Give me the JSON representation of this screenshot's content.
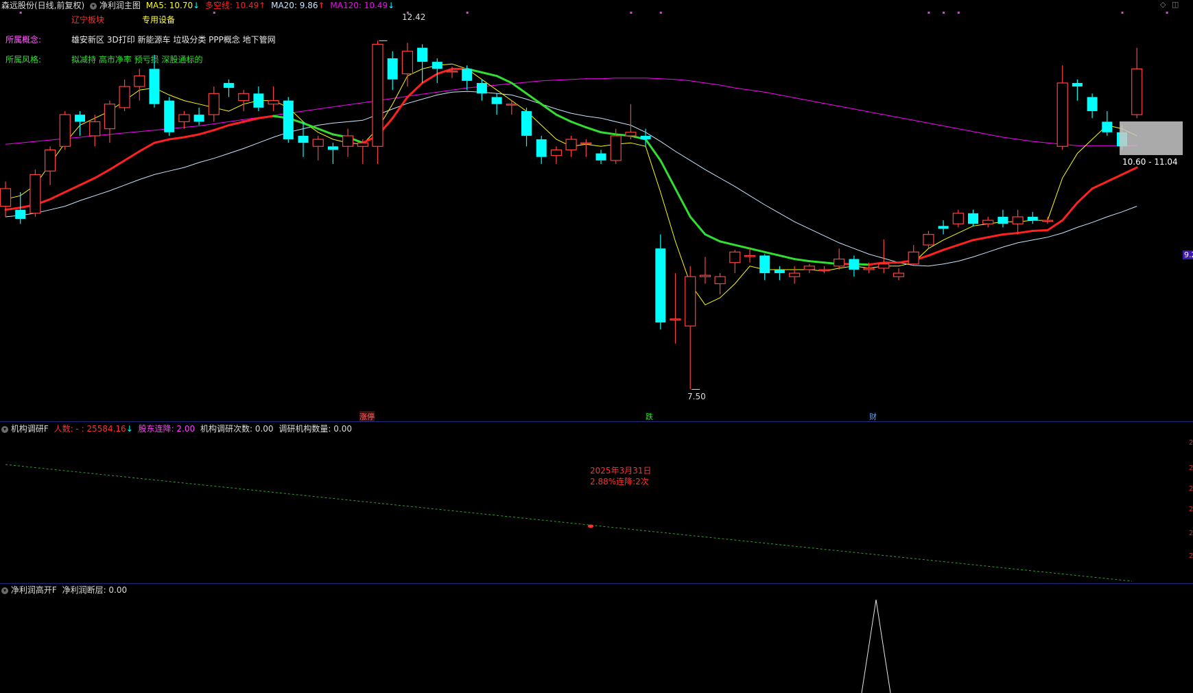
{
  "header": {
    "stock": "森远股份(日线,前复权)",
    "indicator": "净利润主图",
    "ma5_label": "MA5: 10.70",
    "ma5_arrow": "↓",
    "duokong_label": "多空线: 10.49",
    "duokong_arrow": "↑",
    "ma20_label": "MA20: 9.86",
    "ma20_arrow": "↑",
    "ma120_label": "MA120: 10.49",
    "ma120_arrow": "↓"
  },
  "info": {
    "sector": "辽宁板块",
    "equipment": "专用设备",
    "concept_label": "所属概念:",
    "concept_value": "雄安新区 3D打印 新能源车 垃圾分类 PPP概念 地下管网",
    "style_label": "所属风格:",
    "style_value": "拟减持 高市净率 预亏损 深股通标的"
  },
  "annotations": {
    "high": "12.42",
    "low": "7.50",
    "range_box": "10.60 - 11.04",
    "price_tag": "9.2",
    "event1": "涨停",
    "event2": "跌",
    "event3": "财"
  },
  "panel2": {
    "title": "机构调研F",
    "people_label": "人数: - : 25584.16",
    "people_arrow": "↓",
    "holder_label": "股东连降: 2.00",
    "visits_label": "机构调研次数: 0.00",
    "orgs_label": "调研机构数量: 0.00",
    "note_date": "2025年3月31日",
    "note_text": "2.88%连降:2次"
  },
  "panel3": {
    "title": "净利润高开F",
    "label": "净利润断层: 0.00"
  },
  "colors": {
    "up": "#ff4040",
    "down": "#00ffff",
    "ma5": "#ffff00",
    "ma120": "#ff00ff",
    "ma20": "#c8e6ff",
    "duokong_up": "#ff2020",
    "duokong_down": "#30e030",
    "panel_border": "#1e2a80"
  },
  "chart_data": {
    "type": "candlestick",
    "candles": [
      {
        "o": 10.1,
        "h": 10.45,
        "l": 9.95,
        "c": 10.35
      },
      {
        "o": 10.05,
        "h": 10.3,
        "l": 9.85,
        "c": 9.92
      },
      {
        "o": 10.0,
        "h": 10.62,
        "l": 9.95,
        "c": 10.55
      },
      {
        "o": 10.6,
        "h": 10.95,
        "l": 10.4,
        "c": 10.9
      },
      {
        "o": 10.95,
        "h": 11.45,
        "l": 10.9,
        "c": 11.4
      },
      {
        "o": 11.4,
        "h": 11.45,
        "l": 11.1,
        "c": 11.3
      },
      {
        "o": 11.1,
        "h": 11.4,
        "l": 10.95,
        "c": 11.3
      },
      {
        "o": 11.2,
        "h": 11.6,
        "l": 11.0,
        "c": 11.55
      },
      {
        "o": 11.5,
        "h": 11.9,
        "l": 11.45,
        "c": 11.8
      },
      {
        "o": 11.8,
        "h": 12.05,
        "l": 11.6,
        "c": 11.95
      },
      {
        "o": 12.05,
        "h": 12.25,
        "l": 11.5,
        "c": 11.55
      },
      {
        "o": 11.6,
        "h": 11.65,
        "l": 11.1,
        "c": 11.15
      },
      {
        "o": 11.3,
        "h": 11.45,
        "l": 11.2,
        "c": 11.4
      },
      {
        "o": 11.4,
        "h": 11.5,
        "l": 11.25,
        "c": 11.3
      },
      {
        "o": 11.4,
        "h": 11.8,
        "l": 11.3,
        "c": 11.7
      },
      {
        "o": 11.85,
        "h": 11.9,
        "l": 11.65,
        "c": 11.78
      },
      {
        "o": 11.6,
        "h": 11.75,
        "l": 11.45,
        "c": 11.7
      },
      {
        "o": 11.7,
        "h": 11.8,
        "l": 11.45,
        "c": 11.5
      },
      {
        "o": 11.55,
        "h": 11.8,
        "l": 11.45,
        "c": 11.6
      },
      {
        "o": 11.6,
        "h": 11.65,
        "l": 11.0,
        "c": 11.05
      },
      {
        "o": 11.1,
        "h": 11.3,
        "l": 10.8,
        "c": 11.0
      },
      {
        "o": 10.95,
        "h": 11.1,
        "l": 10.75,
        "c": 11.05
      },
      {
        "o": 10.95,
        "h": 11.0,
        "l": 10.7,
        "c": 10.9
      },
      {
        "o": 10.95,
        "h": 11.2,
        "l": 10.8,
        "c": 11.1
      },
      {
        "o": 10.95,
        "h": 11.05,
        "l": 10.7,
        "c": 11.0
      },
      {
        "o": 10.95,
        "h": 12.45,
        "l": 10.7,
        "c": 12.4
      },
      {
        "o": 12.2,
        "h": 12.3,
        "l": 11.75,
        "c": 11.9
      },
      {
        "o": 11.98,
        "h": 12.42,
        "l": 11.8,
        "c": 12.3
      },
      {
        "o": 12.35,
        "h": 12.4,
        "l": 11.85,
        "c": 12.15
      },
      {
        "o": 12.15,
        "h": 12.2,
        "l": 11.85,
        "c": 12.05
      },
      {
        "o": 12.02,
        "h": 12.08,
        "l": 11.92,
        "c": 12.02
      },
      {
        "o": 12.05,
        "h": 12.1,
        "l": 11.75,
        "c": 11.88
      },
      {
        "o": 11.85,
        "h": 11.9,
        "l": 11.6,
        "c": 11.7
      },
      {
        "o": 11.65,
        "h": 11.7,
        "l": 11.4,
        "c": 11.55
      },
      {
        "o": 11.55,
        "h": 11.6,
        "l": 11.4,
        "c": 11.55
      },
      {
        "o": 11.45,
        "h": 11.5,
        "l": 10.95,
        "c": 11.1
      },
      {
        "o": 11.05,
        "h": 11.1,
        "l": 10.7,
        "c": 10.8
      },
      {
        "o": 10.82,
        "h": 10.95,
        "l": 10.7,
        "c": 10.9
      },
      {
        "o": 10.9,
        "h": 11.1,
        "l": 10.8,
        "c": 11.05
      },
      {
        "o": 11.0,
        "h": 11.05,
        "l": 10.8,
        "c": 11.0
      },
      {
        "o": 10.85,
        "h": 10.9,
        "l": 10.7,
        "c": 10.75
      },
      {
        "o": 10.75,
        "h": 11.2,
        "l": 10.7,
        "c": 11.1
      },
      {
        "o": 11.1,
        "h": 11.55,
        "l": 11.05,
        "c": 11.15
      },
      {
        "o": 11.1,
        "h": 11.2,
        "l": 10.95,
        "c": 11.05
      },
      {
        "o": 9.5,
        "h": 9.7,
        "l": 8.35,
        "c": 8.45
      },
      {
        "o": 8.5,
        "h": 9.15,
        "l": 8.15,
        "c": 8.5
      },
      {
        "o": 8.4,
        "h": 9.25,
        "l": 7.5,
        "c": 9.1
      },
      {
        "o": 9.1,
        "h": 9.38,
        "l": 9.0,
        "c": 9.12
      },
      {
        "o": 9.0,
        "h": 9.15,
        "l": 8.85,
        "c": 9.1
      },
      {
        "o": 9.3,
        "h": 9.48,
        "l": 9.15,
        "c": 9.45
      },
      {
        "o": 9.4,
        "h": 9.5,
        "l": 9.3,
        "c": 9.4
      },
      {
        "o": 9.4,
        "h": 9.42,
        "l": 9.05,
        "c": 9.15
      },
      {
        "o": 9.2,
        "h": 9.25,
        "l": 9.05,
        "c": 9.15
      },
      {
        "o": 9.1,
        "h": 9.25,
        "l": 9.0,
        "c": 9.15
      },
      {
        "o": 9.2,
        "h": 9.28,
        "l": 9.15,
        "c": 9.25
      },
      {
        "o": 9.2,
        "h": 9.25,
        "l": 9.15,
        "c": 9.2
      },
      {
        "o": 9.25,
        "h": 9.5,
        "l": 9.2,
        "c": 9.35
      },
      {
        "o": 9.35,
        "h": 9.4,
        "l": 9.1,
        "c": 9.2
      },
      {
        "o": 9.2,
        "h": 9.3,
        "l": 9.15,
        "c": 9.22
      },
      {
        "o": 9.22,
        "h": 9.63,
        "l": 9.15,
        "c": 9.28
      },
      {
        "o": 9.1,
        "h": 9.22,
        "l": 9.05,
        "c": 9.15
      },
      {
        "o": 9.28,
        "h": 9.55,
        "l": 9.25,
        "c": 9.45
      },
      {
        "o": 9.55,
        "h": 9.75,
        "l": 9.5,
        "c": 9.7
      },
      {
        "o": 9.82,
        "h": 9.9,
        "l": 9.7,
        "c": 9.78
      },
      {
        "o": 9.85,
        "h": 10.05,
        "l": 9.8,
        "c": 10.0
      },
      {
        "o": 10.0,
        "h": 10.05,
        "l": 9.82,
        "c": 9.85
      },
      {
        "o": 9.85,
        "h": 9.95,
        "l": 9.8,
        "c": 9.9
      },
      {
        "o": 9.95,
        "h": 10.05,
        "l": 9.8,
        "c": 9.85
      },
      {
        "o": 9.85,
        "h": 10.05,
        "l": 9.7,
        "c": 9.95
      },
      {
        "o": 9.95,
        "h": 10.02,
        "l": 9.85,
        "c": 9.9
      },
      {
        "o": 9.9,
        "h": 9.95,
        "l": 9.85,
        "c": 9.9
      },
      {
        "o": 10.95,
        "h": 12.1,
        "l": 10.9,
        "c": 11.85
      },
      {
        "o": 11.85,
        "h": 11.9,
        "l": 11.6,
        "c": 11.8
      },
      {
        "o": 11.65,
        "h": 11.7,
        "l": 11.35,
        "c": 11.45
      },
      {
        "o": 11.3,
        "h": 11.45,
        "l": 11.1,
        "c": 11.15
      },
      {
        "o": 11.15,
        "h": 11.25,
        "l": 10.9,
        "c": 10.95
      },
      {
        "o": 11.4,
        "h": 12.35,
        "l": 11.35,
        "c": 12.05
      }
    ],
    "ma5": [
      10.2,
      10.25,
      10.4,
      10.7,
      11.0,
      11.25,
      11.35,
      11.45,
      11.6,
      11.75,
      11.78,
      11.68,
      11.6,
      11.55,
      11.5,
      11.45,
      11.55,
      11.6,
      11.6,
      11.5,
      11.3,
      11.15,
      11.05,
      11.0,
      10.98,
      11.2,
      11.55,
      11.95,
      12.05,
      12.1,
      12.12,
      12.05,
      11.9,
      11.75,
      11.6,
      11.45,
      11.25,
      11.05,
      10.95,
      10.98,
      10.95,
      10.98,
      11.0,
      10.95,
      10.3,
      9.6,
      9.0,
      8.7,
      8.8,
      9.0,
      9.25,
      9.2,
      9.2,
      9.2,
      9.2,
      9.18,
      9.22,
      9.25,
      9.22,
      9.25,
      9.25,
      9.3,
      9.5,
      9.62,
      9.72,
      9.82,
      9.85,
      9.88,
      9.88,
      9.9,
      9.9,
      10.5,
      10.85,
      11.05,
      11.25,
      11.2,
      11.1
    ],
    "ma20": [
      9.95,
      9.97,
      10.0,
      10.05,
      10.1,
      10.18,
      10.25,
      10.32,
      10.4,
      10.48,
      10.55,
      10.6,
      10.65,
      10.72,
      10.78,
      10.85,
      10.92,
      11.0,
      11.08,
      11.15,
      11.2,
      11.25,
      11.28,
      11.3,
      11.32,
      11.4,
      11.48,
      11.56,
      11.62,
      11.68,
      11.72,
      11.73,
      11.72,
      11.7,
      11.68,
      11.62,
      11.55,
      11.48,
      11.42,
      11.38,
      11.35,
      11.3,
      11.25,
      11.15,
      11.02,
      10.88,
      10.75,
      10.62,
      10.5,
      10.38,
      10.25,
      10.12,
      10.0,
      9.88,
      9.78,
      9.68,
      9.58,
      9.5,
      9.42,
      9.36,
      9.3,
      9.26,
      9.25,
      9.28,
      9.32,
      9.38,
      9.45,
      9.52,
      9.58,
      9.62,
      9.66,
      9.72,
      9.8,
      9.87,
      9.95,
      10.02,
      10.1
    ],
    "ma120": [
      10.98,
      11.0,
      11.02,
      11.04,
      11.06,
      11.08,
      11.1,
      11.12,
      11.14,
      11.16,
      11.18,
      11.2,
      11.22,
      11.24,
      11.27,
      11.3,
      11.33,
      11.36,
      11.39,
      11.42,
      11.45,
      11.48,
      11.51,
      11.54,
      11.57,
      11.6,
      11.63,
      11.66,
      11.69,
      11.72,
      11.75,
      11.78,
      11.8,
      11.82,
      11.84,
      11.86,
      11.88,
      11.89,
      11.9,
      11.91,
      11.91,
      11.92,
      11.92,
      11.92,
      11.91,
      11.9,
      11.88,
      11.85,
      11.82,
      11.78,
      11.75,
      11.72,
      11.68,
      11.64,
      11.6,
      11.56,
      11.52,
      11.48,
      11.44,
      11.4,
      11.36,
      11.32,
      11.28,
      11.24,
      11.2,
      11.16,
      11.12,
      11.08,
      11.05,
      11.02,
      11.0,
      10.98,
      10.96,
      10.96,
      10.96,
      10.96,
      10.96
    ],
    "duokong": [
      10.05,
      10.08,
      10.12,
      10.2,
      10.3,
      10.4,
      10.5,
      10.62,
      10.75,
      10.88,
      11.0,
      11.05,
      11.08,
      11.12,
      11.18,
      11.25,
      11.3,
      11.35,
      11.38,
      11.35,
      11.28,
      11.2,
      11.12,
      11.08,
      11.0,
      11.1,
      11.35,
      11.65,
      11.85,
      11.98,
      12.05,
      12.05,
      12.0,
      11.95,
      11.85,
      11.7,
      11.55,
      11.4,
      11.3,
      11.22,
      11.15,
      11.12,
      11.1,
      11.05,
      10.75,
      10.35,
      9.95,
      9.7,
      9.6,
      9.55,
      9.5,
      9.45,
      9.4,
      9.35,
      9.32,
      9.3,
      9.28,
      9.28,
      9.27,
      9.3,
      9.3,
      9.33,
      9.4,
      9.48,
      9.55,
      9.62,
      9.66,
      9.7,
      9.72,
      9.75,
      9.76,
      9.9,
      10.15,
      10.35,
      10.45,
      10.55,
      10.65
    ],
    "ylim": [
      7.3,
      12.95
    ]
  }
}
